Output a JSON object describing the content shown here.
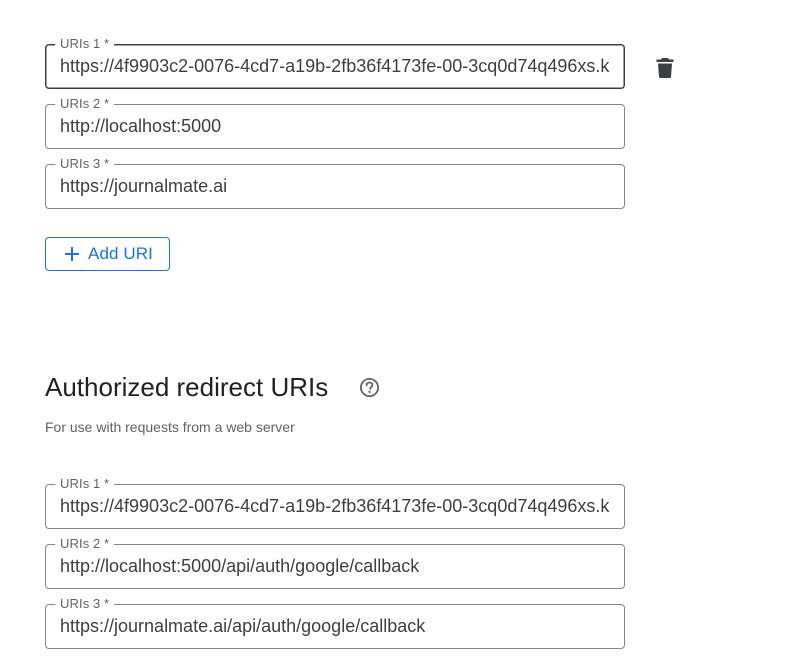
{
  "origins": {
    "fields": [
      {
        "label": "URIs 1 *",
        "value": "https://4f9903c2-0076-4cd7-a19b-2fb36f4173fe-00-3cq0d74q496xs.k"
      },
      {
        "label": "URIs 2 *",
        "value": "http://localhost:5000"
      },
      {
        "label": "URIs 3 *",
        "value": "https://journalmate.ai"
      }
    ],
    "delete_icon": "trash-icon",
    "add_button_label": "Add URI",
    "add_icon": "plus-icon"
  },
  "redirects": {
    "title": "Authorized redirect URIs",
    "help_icon": "help-circle-icon",
    "subtitle": "For use with requests from a web server",
    "fields": [
      {
        "label": "URIs 1 *",
        "value": "https://4f9903c2-0076-4cd7-a19b-2fb36f4173fe-00-3cq0d74q496xs.k"
      },
      {
        "label": "URIs 2 *",
        "value": "http://localhost:5000/api/auth/google/callback"
      },
      {
        "label": "URIs 3 *",
        "value": "https://journalmate.ai/api/auth/google/callback"
      }
    ]
  },
  "colors": {
    "accent": "#1a73e8",
    "text_primary": "#202124",
    "text_secondary": "#5f6368",
    "border": "#80868b"
  }
}
